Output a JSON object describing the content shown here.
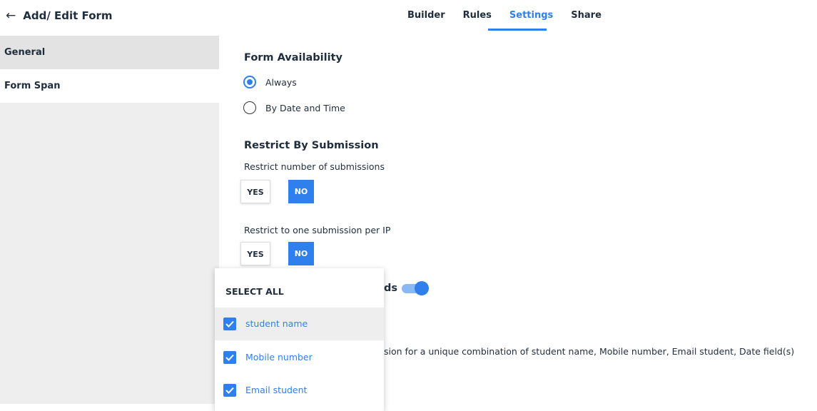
{
  "header": {
    "back_icon": "arrow-left-icon",
    "title": "Add/ Edit Form",
    "tabs": [
      {
        "label": "Builder",
        "active": false
      },
      {
        "label": "Rules",
        "active": false
      },
      {
        "label": "Settings",
        "active": true
      },
      {
        "label": "Share",
        "active": false
      }
    ]
  },
  "sidebar": {
    "items": [
      {
        "label": "General",
        "selected": true
      },
      {
        "label": "Form Span",
        "selected": false
      }
    ]
  },
  "availability": {
    "heading": "Form Availability",
    "options": [
      {
        "label": "Always",
        "checked": true
      },
      {
        "label": "By Date and Time",
        "checked": false
      }
    ]
  },
  "restrict": {
    "heading": "Restrict By Submission",
    "number": {
      "label": "Restrict number of submissions",
      "yes": "YES",
      "no": "NO",
      "value": "NO"
    },
    "ip": {
      "label": "Restrict to one submission per IP",
      "yes": "YES",
      "no": "NO",
      "value": "NO"
    },
    "fields_partial_label": "ds",
    "fields_toggle_on": true,
    "unique_text_partial": "sion for a unique combination of student name, Mobile number, Email student, Date field(s)"
  },
  "dropdown": {
    "select_all": "SELECT ALL",
    "items": [
      {
        "label": "student name",
        "checked": true
      },
      {
        "label": "Mobile number",
        "checked": true
      },
      {
        "label": "Email student",
        "checked": true
      }
    ]
  },
  "colors": {
    "accent": "#2f80ed",
    "text": "#1f2d3d",
    "sidebar_bg": "#eeeeee"
  }
}
